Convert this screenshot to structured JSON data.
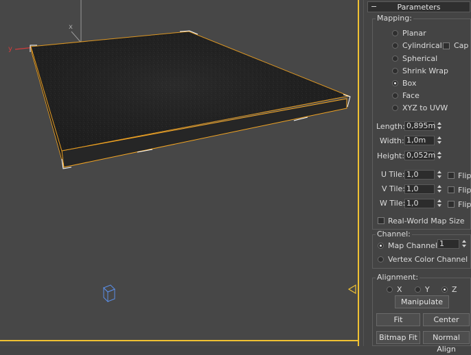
{
  "viewport": {
    "axis_x_label": "x",
    "axis_y_label": "y",
    "colors": {
      "selection_outline": "#f5a623",
      "border": "#f1c232",
      "axis_red": "#d23c3c",
      "cube": "#5b8ee6"
    }
  },
  "panel": {
    "rollout_title": "Parameters",
    "rollout_toggle": "−",
    "mapping": {
      "label": "Mapping:",
      "options": [
        "Planar",
        "Cylindrical",
        "Spherical",
        "Shrink Wrap",
        "Box",
        "Face",
        "XYZ to UVW"
      ],
      "selected": "Box",
      "cap_label": "Cap",
      "length_label": "Length:",
      "length_value": "0,895m",
      "width_label": "Width:",
      "width_value": "1,0m",
      "height_label": "Height:",
      "height_value": "0,052m",
      "utile_label": "U Tile:",
      "utile_value": "1,0",
      "vtile_label": "V Tile:",
      "vtile_value": "1,0",
      "wtile_label": "W Tile:",
      "wtile_value": "1,0",
      "flip_label": "Flip",
      "realworld_label": "Real-World Map Size"
    },
    "channel": {
      "label": "Channel:",
      "map_channel_label": "Map Channel:",
      "map_channel_value": "1",
      "vertex_color_label": "Vertex Color Channel"
    },
    "alignment": {
      "label": "Alignment:",
      "x": "X",
      "y": "Y",
      "z": "Z",
      "selected": "Z",
      "manipulate": "Manipulate",
      "fit": "Fit",
      "center": "Center",
      "bitmap_fit": "Bitmap Fit",
      "normal_align": "Normal Align"
    }
  }
}
